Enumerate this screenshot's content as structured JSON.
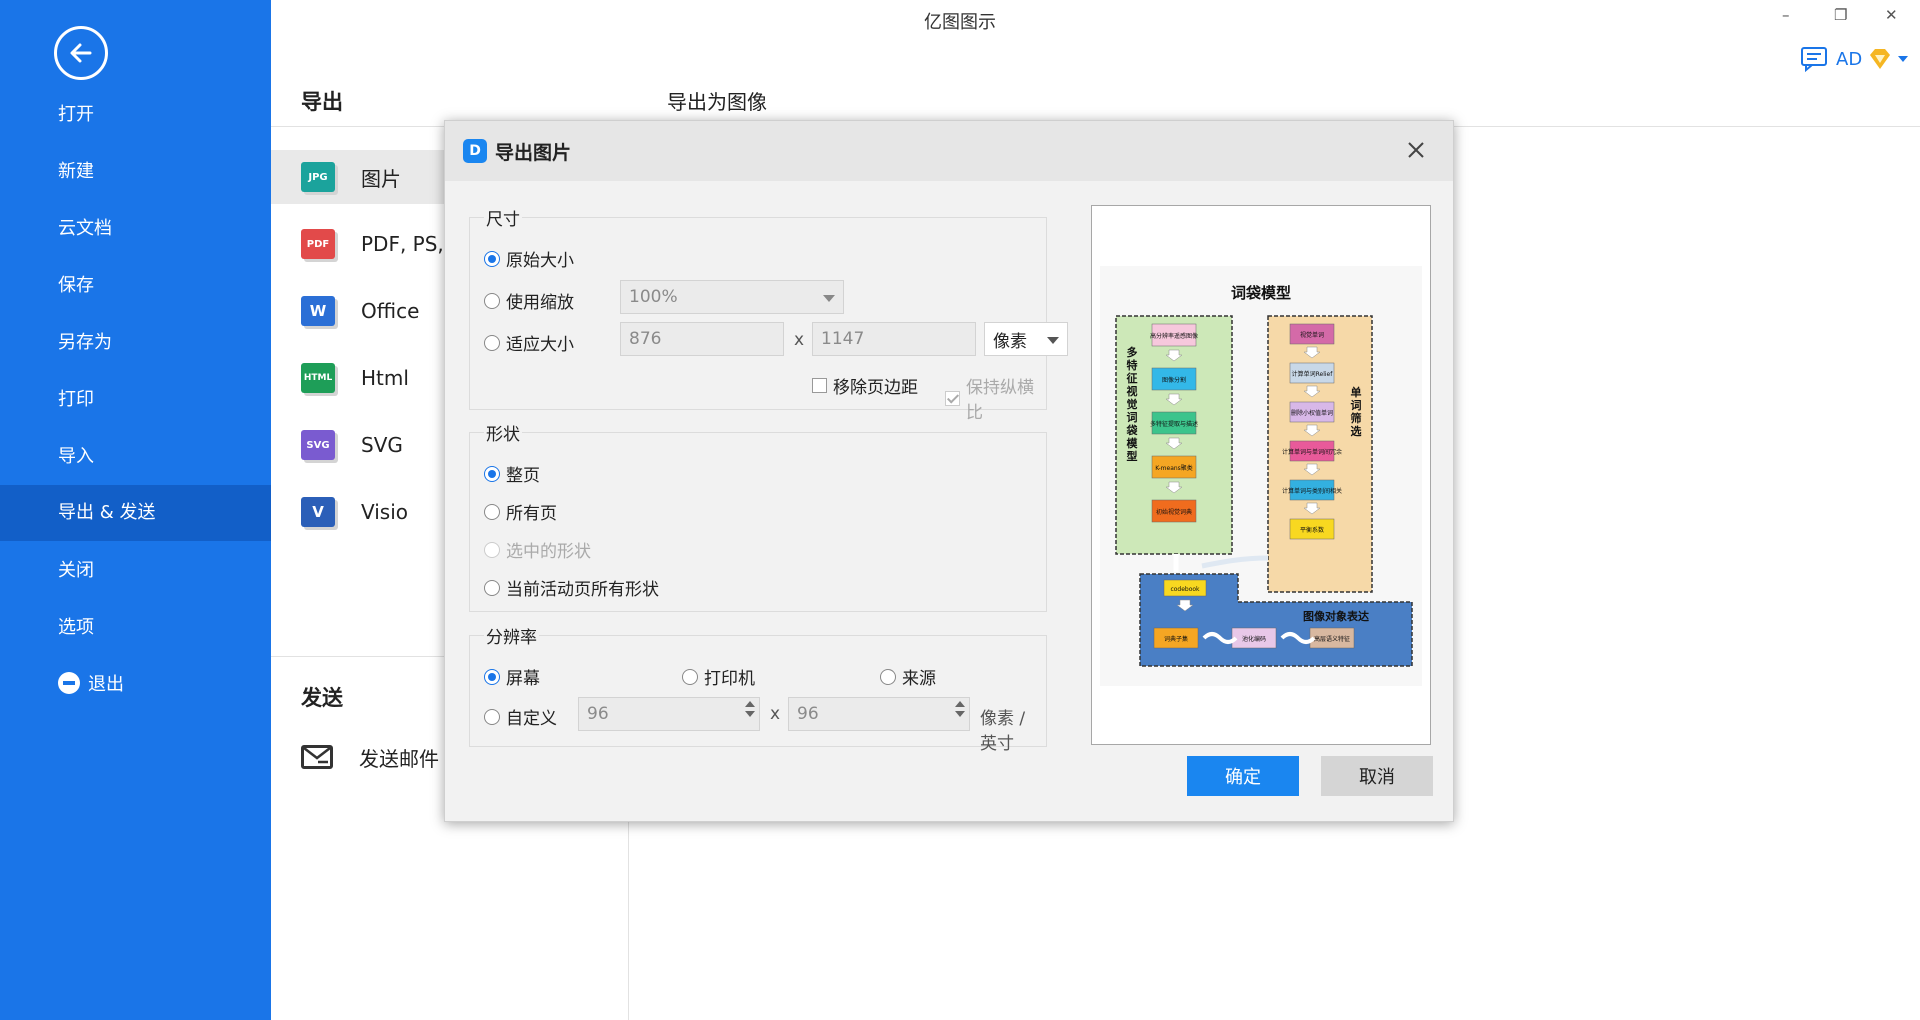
{
  "app": {
    "title": "亿图图示"
  },
  "window": {
    "minimize": "–",
    "restore": "❐",
    "close": "✕"
  },
  "user": {
    "name": "AD"
  },
  "sidebar": {
    "items": [
      {
        "label": "打开"
      },
      {
        "label": "新建"
      },
      {
        "label": "云文档"
      },
      {
        "label": "保存"
      },
      {
        "label": "另存为"
      },
      {
        "label": "打印"
      },
      {
        "label": "导入"
      },
      {
        "label": "导出 & 发送",
        "active": true
      },
      {
        "label": "关闭"
      },
      {
        "label": "选项"
      },
      {
        "label": "退出"
      }
    ]
  },
  "panel": {
    "export_title": "导出",
    "send_title": "发送",
    "right_heading": "导出为图像",
    "formats": [
      {
        "label": "图片",
        "icon": "JPG",
        "color": "#1ba39c"
      },
      {
        "label": "PDF, PS,",
        "icon": "PDF",
        "color": "#e24a4a"
      },
      {
        "label": "Office",
        "icon": "W",
        "color": "#2b6fd6"
      },
      {
        "label": "Html",
        "icon": "HTML",
        "color": "#1e9e58"
      },
      {
        "label": "SVG",
        "icon": "SVG",
        "color": "#7a5bd0"
      },
      {
        "label": "Visio",
        "icon": "V",
        "color": "#2b5fb8"
      }
    ],
    "send_mail": "发送邮件"
  },
  "dialog": {
    "title": "导出图片",
    "size": {
      "label": "尺寸",
      "original": "原始大小",
      "scale": "使用缩放",
      "scale_value": "100%",
      "fit": "适应大小",
      "width": "876",
      "x": "x",
      "height": "1147",
      "unit": "像素",
      "remove_margin": "移除页边距",
      "keep_ratio": "保持纵横比"
    },
    "shape": {
      "label": "形状",
      "whole_page": "整页",
      "all_pages": "所有页",
      "selected": "选中的形状",
      "current_page_all": "当前活动页所有形状"
    },
    "resolution": {
      "label": "分辨率",
      "screen": "屏幕",
      "printer": "打印机",
      "source": "来源",
      "custom": "自定义",
      "dpi_x": "96",
      "x": "x",
      "dpi_y": "96",
      "unit": "像素 / 英寸"
    },
    "ok": "确定",
    "cancel": "取消",
    "preview": {
      "title": "词袋模型",
      "left_label": "多特征视觉词袋模型",
      "right_label": "单词筛选",
      "bottom_label": "图像对象表达",
      "left_steps": [
        "高分辨率遥感图像",
        "图像分割",
        "多特征提取与描述",
        "K-means聚类",
        "初始视觉词典"
      ],
      "right_steps": [
        "视觉单词",
        "计算单词Relief权值",
        "删除小权值单词",
        "计算单词与单词间冗余性",
        "计算单词与类别间相关性",
        "平衡系数"
      ],
      "bottom_steps": [
        "codebook",
        "词典子集",
        "池化编码",
        "高层语义特征"
      ]
    }
  }
}
